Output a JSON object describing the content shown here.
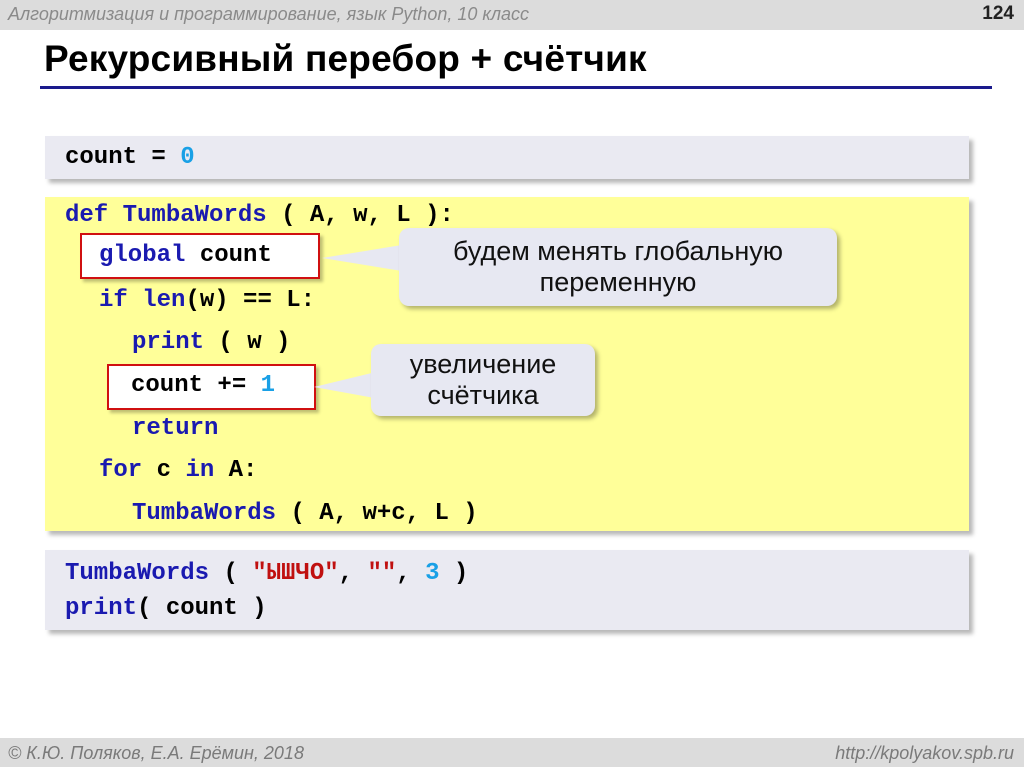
{
  "header": {
    "subject": "Алгоритмизация и программирование, язык Python, 10 класс",
    "slide_number": "124"
  },
  "title": "Рекурсивный перебор + счётчик",
  "code_top": {
    "var": "count",
    "op": "=",
    "value": "0"
  },
  "code_func": {
    "line1": {
      "kw": "def",
      "name": "TumbaWords",
      "args": "( A, w, L ):"
    },
    "line2": {
      "kw": "global",
      "rest": "count"
    },
    "line3": {
      "kw": "if",
      "func": "len",
      "rest": "(w) == L:"
    },
    "line4": {
      "func": "print",
      "rest": "( w )"
    },
    "line5": {
      "rest": "count += ",
      "num": "1"
    },
    "line6": {
      "kw": "return"
    },
    "line7": {
      "kw": "for",
      "mid": "c",
      "kw2": "in",
      "rest": "A:"
    },
    "line8": {
      "name": "TumbaWords",
      "rest": "( A, w+c, L )"
    }
  },
  "code_call": {
    "line1": {
      "name": "TumbaWords",
      "open": "(",
      "str1": "\"ЫШЧО\"",
      "comma1": ",",
      "str2": "\"\"",
      "comma2": ",",
      "num": "3",
      "close": ")"
    },
    "line2": {
      "func": "print",
      "rest": "( count )"
    }
  },
  "callouts": {
    "global_note": "будем менять глобальную переменную",
    "counter_note": "увеличение счётчика"
  },
  "footer": {
    "copyright": "© К.Ю. Поляков, Е.А. Ерёмин, 2018",
    "site": "http://kpolyakov.spb.ru"
  },
  "colors": {
    "keyword": "#1a1ab0",
    "number": "#19a0e6",
    "string": "#c01010",
    "highlight_box": "#ffff99",
    "code_box": "#eaeaf2",
    "title_rule": "#1a1a8c"
  }
}
